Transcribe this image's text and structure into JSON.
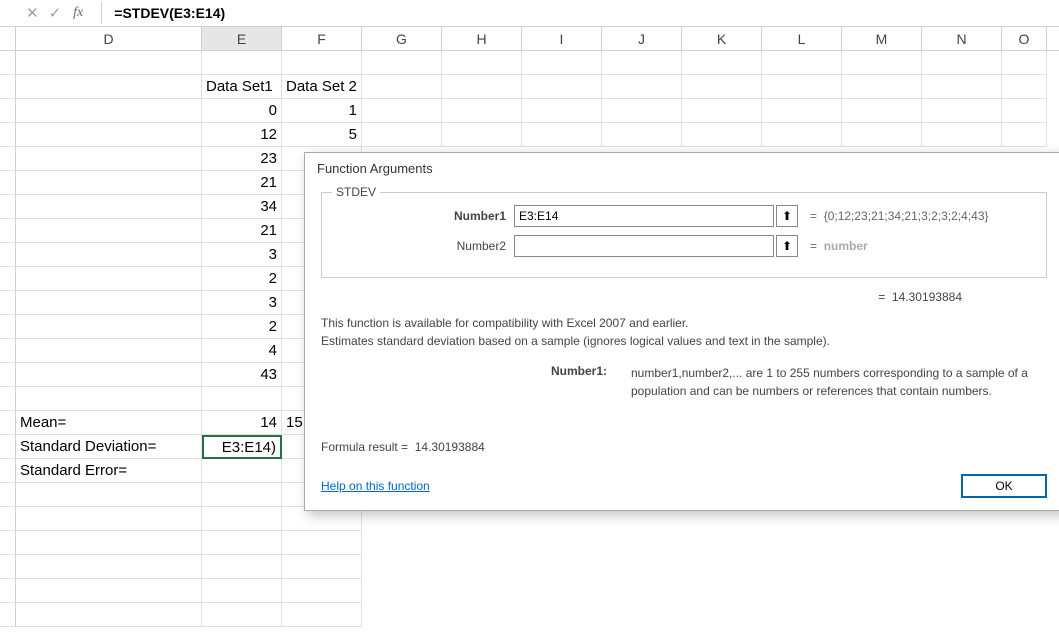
{
  "formula_bar": {
    "content": "=STDEV(E3:E14)"
  },
  "columns": [
    "D",
    "E",
    "F",
    "G",
    "H",
    "I",
    "J",
    "K",
    "L",
    "M",
    "N",
    "O"
  ],
  "active_col": "E",
  "headers": {
    "e": "Data Set1",
    "f": "Data Set 2"
  },
  "data_e": [
    "0",
    "12",
    "23",
    "21",
    "34",
    "21",
    "3",
    "2",
    "3",
    "2",
    "4",
    "43"
  ],
  "data_f_visible": [
    "1",
    "5"
  ],
  "labels": {
    "mean": "Mean=",
    "stddev": "Standard Deviation=",
    "stderr": "Standard Error="
  },
  "results": {
    "mean_e": "14",
    "mean_f_partial": "15",
    "stddev_e_cell": "E3:E14)"
  },
  "dialog": {
    "title": "Function Arguments",
    "function_name": "STDEV",
    "args": [
      {
        "label": "Number1",
        "value": "E3:E14",
        "result": "{0;12;23;21;34;21;3;2;3;2;4;43}",
        "bold": true
      },
      {
        "label": "Number2",
        "value": "",
        "result": "number",
        "bold": false,
        "placeholder": true
      }
    ],
    "result_value": "14.30193884",
    "description_line1": "This function is available for compatibility with Excel 2007 and earlier.",
    "description_line2": "Estimates standard deviation based on a sample (ignores logical values and text in the sample).",
    "param_name": "Number1:",
    "param_desc": "number1,number2,... are 1 to 255 numbers corresponding to a sample of a population and can be numbers or references that contain numbers.",
    "formula_result_label": "Formula result = ",
    "formula_result_value": "14.30193884",
    "help_text": "Help on this function",
    "ok_label": "OK",
    "eq": "="
  }
}
